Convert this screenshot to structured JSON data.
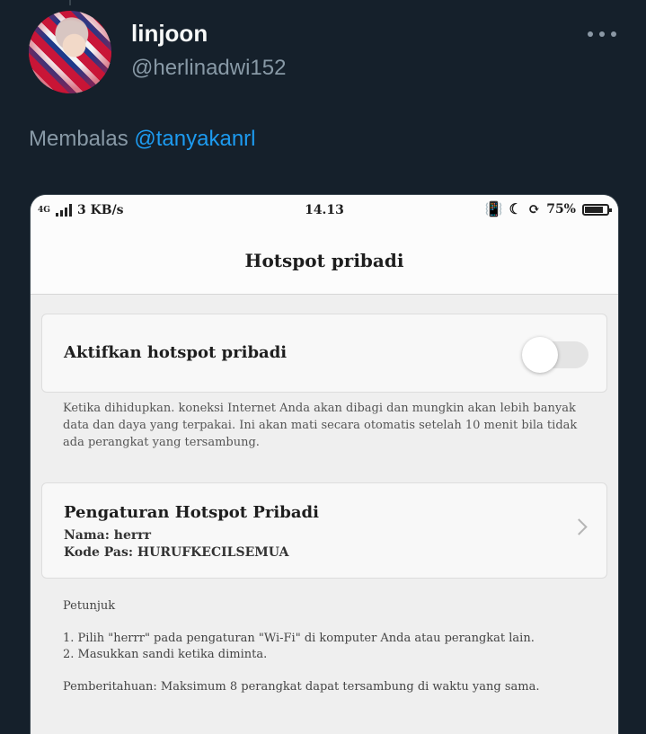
{
  "tweet": {
    "display_name": "linjoon",
    "handle": "@herlinadwi152",
    "reply_prefix": "Membalas",
    "reply_mention": "@tanyakanrl"
  },
  "phone": {
    "status_bar": {
      "network": "4G",
      "speed": "3 KB/s",
      "time": "14.13",
      "battery": "75%"
    },
    "header_title": "Hotspot pribadi",
    "toggle": {
      "label": "Aktifkan hotspot pribadi",
      "state": "off"
    },
    "description": "Ketika dihidupkan. koneksi Internet Anda akan dibagi dan mungkin akan lebih banyak data dan daya yang terpakai. Ini akan mati secara otomatis setelah 10 menit bila tidak ada perangkat yang tersambung.",
    "settings": {
      "title": "Pengaturan Hotspot Pribadi",
      "name_line": "Nama: herrr",
      "password_line": "Kode Pas: HURUFKECILSEMUA"
    },
    "instructions": {
      "heading": "Petunjuk",
      "step1": "1. Pilih \"herrr\" pada pengaturan \"Wi-Fi\" di komputer Anda atau perangkat lain.",
      "step2": "2. Masukkan sandi ketika diminta.",
      "notice": "Pemberitahuan: Maksimum 8 perangkat dapat tersambung di waktu yang sama."
    }
  },
  "icons": {
    "more": "more-horizontal-icon",
    "signal": "signal-icon",
    "vibrate": "vibrate-off-icon",
    "dnd": "moon-icon",
    "rotation_lock": "rotation-lock-icon",
    "battery": "battery-icon",
    "chevron": "chevron-right-icon"
  },
  "colors": {
    "background": "#15202b",
    "text_secondary": "#8899a6",
    "link": "#1d9bf0"
  }
}
